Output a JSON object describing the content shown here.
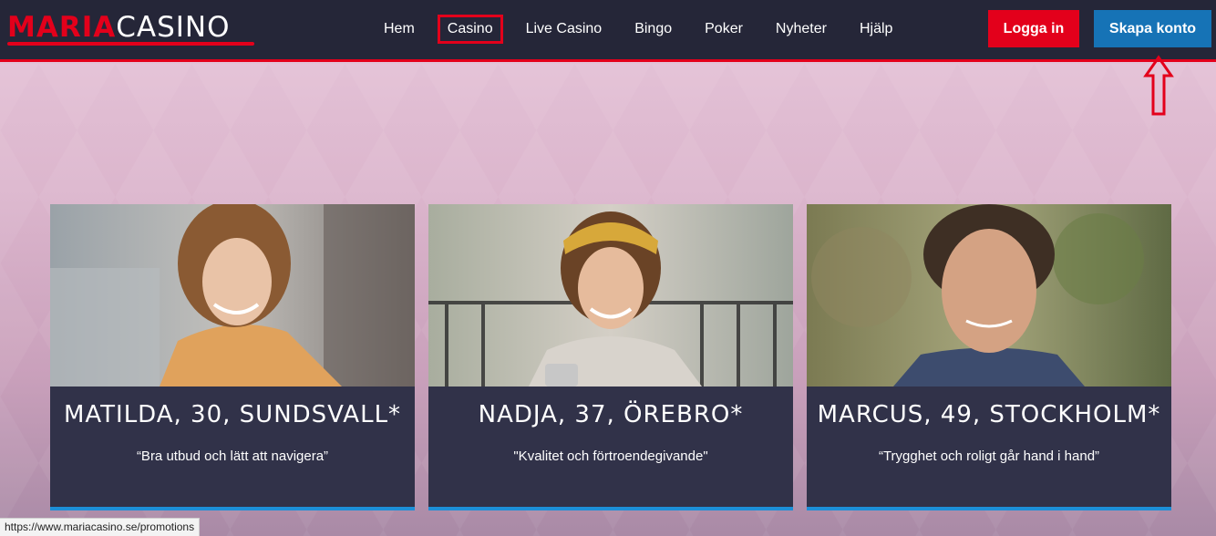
{
  "header": {
    "logo": {
      "part1": "MARIA",
      "part2": "CASINO"
    },
    "nav": [
      {
        "label": "Hem",
        "active": false
      },
      {
        "label": "Casino",
        "active": true
      },
      {
        "label": "Live Casino",
        "active": false
      },
      {
        "label": "Bingo",
        "active": false
      },
      {
        "label": "Poker",
        "active": false
      },
      {
        "label": "Nyheter",
        "active": false
      },
      {
        "label": "Hjälp",
        "active": false
      }
    ],
    "login_label": "Logga in",
    "signup_label": "Skapa konto"
  },
  "cards": [
    {
      "name": "MATILDA, 30, SUNDSVALL*",
      "quote": "“Bra utbud och lätt att navigera”"
    },
    {
      "name": "NADJA, 37, ÖREBRO*",
      "quote": "\"Kvalitet och förtroendegivande\""
    },
    {
      "name": "MARCUS, 49, STOCKHOLM*",
      "quote": "“Trygghet och roligt går hand i hand”"
    }
  ],
  "status_url": "https://www.mariacasino.se/promotions",
  "colors": {
    "brand_red": "#e3001b",
    "header_bg": "#252638",
    "signup_blue": "#1673b6",
    "card_bg": "#313249",
    "card_accent": "#1d8fd8"
  }
}
